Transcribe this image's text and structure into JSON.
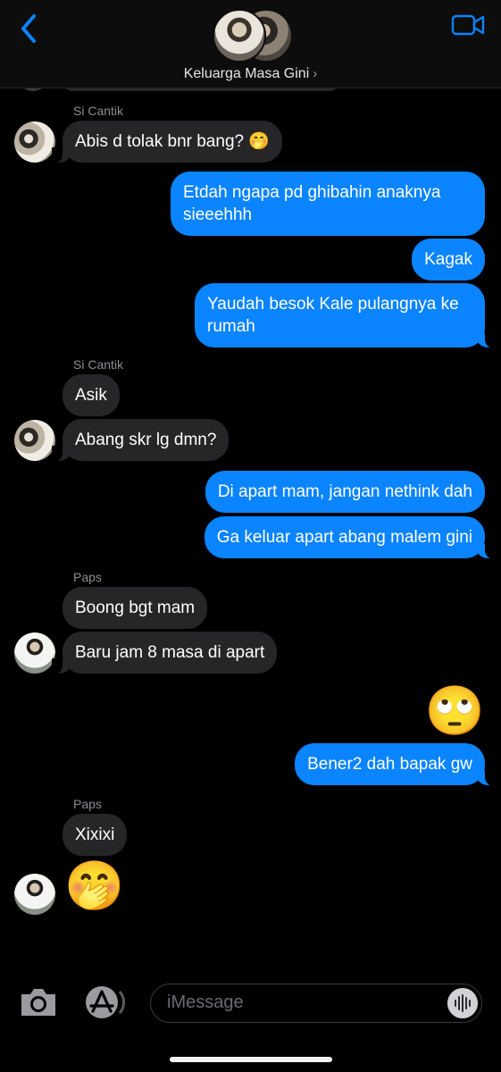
{
  "header": {
    "group_name": "Keluarga Masa Gini",
    "chevron": "›",
    "back_icon": "chevron-left-icon",
    "video_icon": "video-camera-icon",
    "accent": "#0a84ff"
  },
  "messages": [
    {
      "sender": "Si Cantik",
      "text": "Abis d tolak bnr bang? 🤭"
    },
    {
      "text": "Etdah ngapa pd ghibahin anaknya sieeehhh",
      "line1": "Etdah ngapa pd ghibahin anaknya",
      "line2": "sieeehhh"
    },
    {
      "text": "Kagak"
    },
    {
      "text": "Yaudah besok Kale pulangnya ke rumah",
      "line1": "Yaudah besok Kale pulangnya ke",
      "line2": "rumah"
    },
    {
      "sender": "Si Cantik",
      "text": "Asik"
    },
    {
      "text": "Abang skr lg dmn?"
    },
    {
      "text": "Di apart mam, jangan nethink dah"
    },
    {
      "text": "Ga keluar apart abang malem gini"
    },
    {
      "sender": "Paps",
      "text": "Boong bgt mam"
    },
    {
      "text": "Baru jam 8 masa di apart"
    },
    {
      "emoji": "🙄"
    },
    {
      "text": "Bener2 dah bapak gw"
    },
    {
      "sender": "Paps",
      "text": "Xixixi"
    },
    {
      "emoji": "🤭"
    }
  ],
  "input": {
    "placeholder": "iMessage"
  },
  "colors": {
    "incoming_bubble": "#262628",
    "outgoing_bubble": "#0a84ff",
    "background": "#000000"
  }
}
